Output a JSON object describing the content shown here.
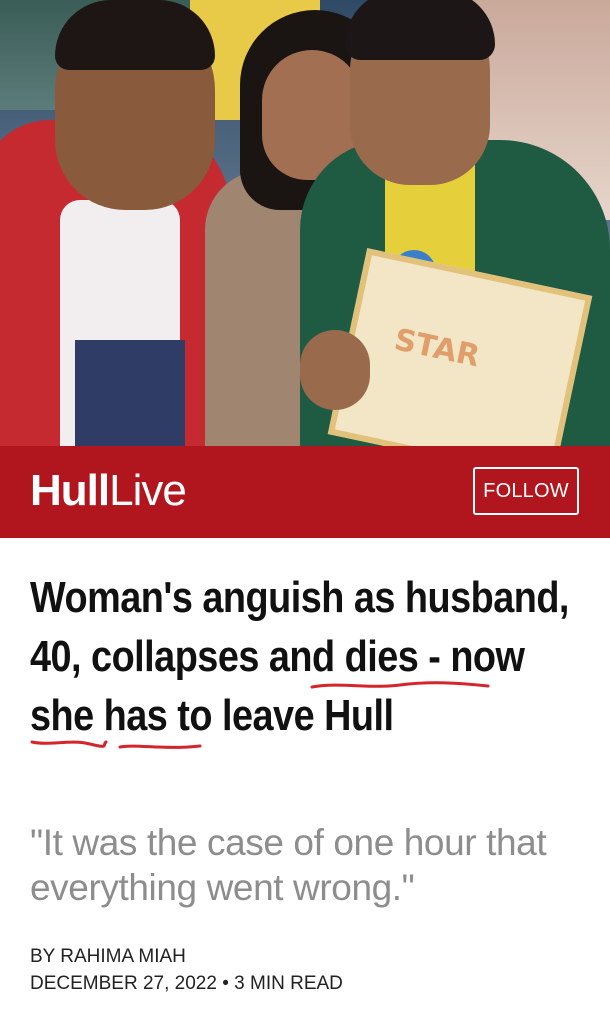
{
  "publisher": {
    "logo_part1": "Hull",
    "logo_part2": "Live",
    "follow_label": "FOLLOW",
    "brand_color": "#b1151d"
  },
  "hero_image": {
    "icon": "photo-image",
    "card_text": "STAR"
  },
  "article": {
    "headline": "Woman's anguish as husband, 40, collapses and dies - now she has to leave Hull",
    "standfirst": "\"It was the case of one hour that everything went wrong.\"",
    "byline": "BY RAHIMA MIAH",
    "date": "DECEMBER 27, 2022",
    "separator": "•",
    "read_time": "3 MIN READ"
  },
  "annotations": {
    "underline_color": "#d4242c"
  }
}
